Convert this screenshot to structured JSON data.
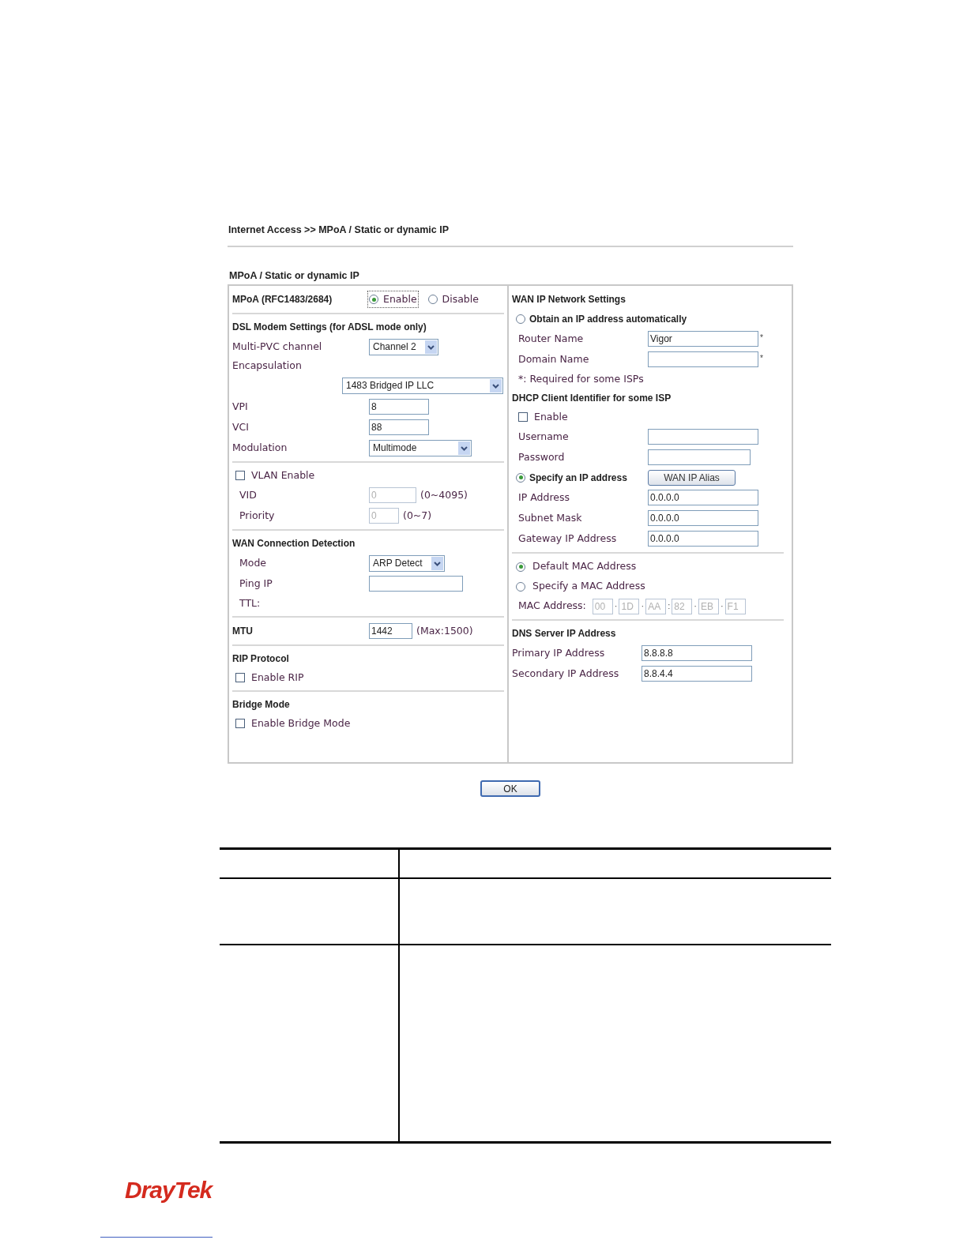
{
  "breadcrumb": "Internet Access >> MPoA / Static or dynamic IP",
  "panel_title": "MPoA / Static or dynamic IP",
  "left_sections": [
    {
      "rows": [
        {
          "kind": "radio_group",
          "label": "MPoA (RFC1483/2684)",
          "options": [
            {
              "label": "Enable",
              "selected": true
            },
            {
              "label": "Disable",
              "selected": false
            }
          ]
        }
      ]
    },
    {
      "rows": [
        {
          "kind": "heading",
          "text": "DSL Modem Settings (for ADSL mode only)"
        },
        {
          "kind": "select",
          "label": "Multi-PVC channel",
          "value": "Channel 2"
        },
        {
          "kind": "select_below",
          "label": "Encapsulation",
          "value": "1483 Bridged IP LLC"
        },
        {
          "kind": "field",
          "label": "VPI",
          "value": "8",
          "disabled": false
        },
        {
          "kind": "field",
          "label": "VCI",
          "value": "88",
          "disabled": false
        },
        {
          "kind": "select",
          "label": "Modulation",
          "value": "Multimode"
        }
      ]
    },
    {
      "rows": [
        {
          "kind": "checkbox",
          "label": "VLAN Enable",
          "checked": false,
          "children": [
            {
              "kind": "field",
              "label": "VID",
              "value": "0",
              "hint": "(0~4095)",
              "disabled": true
            },
            {
              "kind": "field",
              "label": "Priority",
              "value": "0",
              "hint": "(0~7)",
              "disabled": true
            }
          ]
        }
      ]
    },
    {
      "rows": [
        {
          "kind": "heading",
          "text": "WAN Connection Detection",
          "children": [
            {
              "kind": "select",
              "label": "Mode",
              "value": "ARP Detect"
            },
            {
              "kind": "field",
              "label": "Ping IP",
              "disabled": false
            },
            {
              "kind": "label",
              "text": "TTL:"
            }
          ]
        }
      ]
    },
    {
      "rows": [
        {
          "kind": "field",
          "label": "MTU",
          "value": "1442",
          "hint": "(Max:1500)",
          "disabled": false,
          "bold": true
        }
      ]
    },
    {
      "rows": [
        {
          "kind": "heading",
          "text": "RIP Protocol"
        },
        {
          "kind": "checkbox",
          "label": "Enable RIP",
          "checked": false
        }
      ]
    },
    {
      "rows": [
        {
          "kind": "heading",
          "text": "Bridge Mode"
        },
        {
          "kind": "checkbox",
          "label": "Enable Bridge Mode",
          "checked": false
        }
      ]
    }
  ],
  "right_sections": [
    {
      "rows": [
        {
          "kind": "heading",
          "text": "WAN IP Network Settings"
        },
        {
          "kind": "radio",
          "label": "Obtain an IP address automatically",
          "selected": false,
          "children": [
            {
              "kind": "field",
              "label": "Router Name",
              "value": "Vigor",
              "suffix": "*",
              "disabled": false
            },
            {
              "kind": "field",
              "label": "Domain Name",
              "suffix": "*",
              "disabled": false
            },
            {
              "kind": "label",
              "text": "*: Required for some ISPs"
            }
          ]
        },
        {
          "kind": "heading",
          "text": "DHCP Client Identifier for some ISP",
          "children": [
            {
              "kind": "checkbox",
              "label": "Enable",
              "checked": false
            },
            {
              "kind": "field",
              "label": "Username",
              "disabled": false
            },
            {
              "kind": "field",
              "label": "Password",
              "disabled": false
            }
          ]
        },
        {
          "kind": "radio",
          "label": "Specify an IP address",
          "selected": true,
          "button": "WAN IP Alias",
          "children": [
            {
              "kind": "field",
              "label": "IP Address",
              "value": "0.0.0.0",
              "disabled": false
            },
            {
              "kind": "field",
              "label": "Subnet Mask",
              "value": "0.0.0.0",
              "disabled": false
            },
            {
              "kind": "field",
              "label": "Gateway IP Address",
              "value": "0.0.0.0",
              "disabled": false
            }
          ]
        }
      ]
    },
    {
      "rows": [
        {
          "kind": "radio",
          "label": "Default MAC Address",
          "selected": true,
          "plain": true
        },
        {
          "kind": "radio",
          "label": "Specify a MAC Address",
          "selected": false,
          "plain": true,
          "children": [
            {
              "kind": "mac",
              "label": "MAC Address:",
              "disabled": true,
              "parts": [
                {
                  "value": "00"
                },
                {
                  "separator": "·",
                  "value": "1D"
                },
                {
                  "separator": "·",
                  "value": "AA"
                },
                {
                  "separator": ":",
                  "value": "82"
                },
                {
                  "separator": "·",
                  "value": "EB"
                },
                {
                  "separator": "·",
                  "value": "F1"
                }
              ]
            }
          ]
        }
      ]
    },
    {
      "rows": [
        {
          "kind": "heading",
          "text": "DNS Server IP Address"
        },
        {
          "kind": "field",
          "label": "Primary IP Address",
          "value": "8.8.8.8",
          "disabled": false
        },
        {
          "kind": "field",
          "label": "Secondary IP Address",
          "value": "8.8.4.4",
          "disabled": false
        }
      ]
    }
  ],
  "ok_button": "OK",
  "logo": "DrayTek"
}
